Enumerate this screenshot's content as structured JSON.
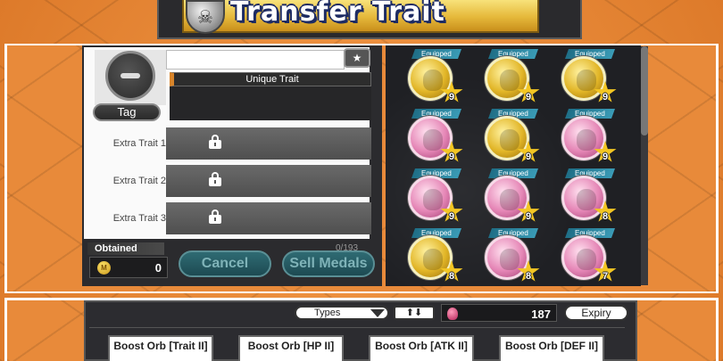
{
  "header": {
    "title": "Transfer Trait",
    "medal_icon": "skull-medal-icon"
  },
  "trait_panel": {
    "unique_trait_label": "Unique Trait",
    "tag_label": "Tag",
    "extra_traits": [
      {
        "label": "Extra Trait 1",
        "locked": true
      },
      {
        "label": "Extra Trait 2",
        "locked": true
      },
      {
        "label": "Extra Trait 3",
        "locked": true
      }
    ],
    "obtained_label": "Obtained",
    "obtained_value": "0",
    "count_label": "0/193",
    "cancel_label": "Cancel",
    "sell_label": "Sell Medals"
  },
  "medals": [
    {
      "tag": "Equipped",
      "color": "gold",
      "level": "9"
    },
    {
      "tag": "Equipped",
      "color": "gold",
      "level": "9"
    },
    {
      "tag": "Equipped",
      "color": "gold",
      "level": "9"
    },
    {
      "tag": "Equipped",
      "color": "pink",
      "level": "9"
    },
    {
      "tag": "Equipped",
      "color": "gold",
      "level": "9"
    },
    {
      "tag": "Equipped",
      "color": "pink",
      "level": "9"
    },
    {
      "tag": "Equipped",
      "color": "pink",
      "level": "9"
    },
    {
      "tag": "Equipped",
      "color": "pink",
      "level": "9"
    },
    {
      "tag": "Equipped",
      "color": "pink",
      "level": "8"
    },
    {
      "tag": "Equipped",
      "color": "gold",
      "level": "8"
    },
    {
      "tag": "Equipped",
      "color": "pink",
      "level": "8"
    },
    {
      "tag": "Equipped",
      "color": "pink",
      "level": "7"
    }
  ],
  "orb_bar": {
    "types_label": "Types",
    "sort_label": "⬆⬇",
    "orb_count": "187",
    "expiry_label": "Expiry",
    "cards": [
      {
        "label": "Boost Orb [Trait II]"
      },
      {
        "label": "Boost Orb [HP II]"
      },
      {
        "label": "Boost Orb [ATK II]"
      },
      {
        "label": "Boost Orb [DEF II]"
      }
    ]
  },
  "colors": {
    "background": "#e88a3a",
    "panel": "#2b2b2e",
    "title_gold": "#e5b83a",
    "equipped_tag": "#3a9bb6",
    "button_teal": "#2f6b73"
  }
}
